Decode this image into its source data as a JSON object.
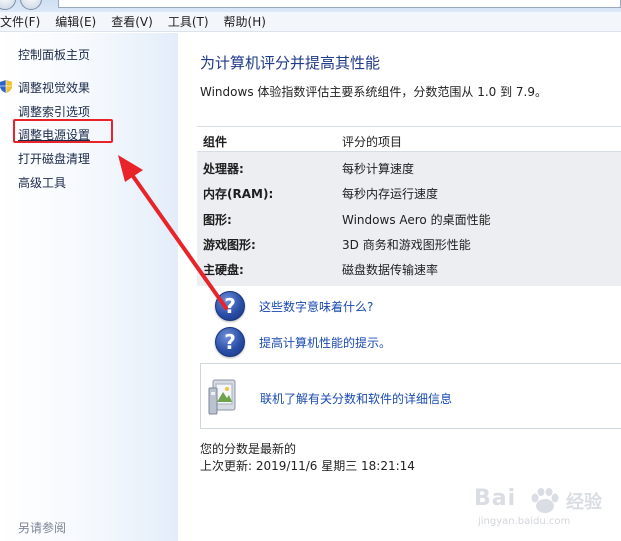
{
  "menu": [
    {
      "label": "文件(F)"
    },
    {
      "label": "编辑(E)"
    },
    {
      "label": "查看(V)"
    },
    {
      "label": "工具(T)"
    },
    {
      "label": "帮助(H)"
    }
  ],
  "sidebar": {
    "items": [
      {
        "label": "控制面板主页"
      },
      {
        "label": "调整视觉效果"
      },
      {
        "label": "调整索引选项"
      },
      {
        "label": "调整电源设置"
      },
      {
        "label": "打开磁盘清理"
      },
      {
        "label": "高级工具"
      }
    ],
    "see_also": "另请参阅"
  },
  "main": {
    "title": "为计算机评分并提高其性能",
    "description": "Windows 体验指数评估主要系统组件，分数范围从 1.0 到 7.9。",
    "table": {
      "headers": [
        "组件",
        "评分的项目"
      ],
      "rows": [
        {
          "component": "处理器:",
          "item": "每秒计算速度"
        },
        {
          "component": "内存(RAM):",
          "item": "每秒内存运行速度"
        },
        {
          "component": "图形:",
          "item": "Windows Aero 的桌面性能"
        },
        {
          "component": "游戏图形:",
          "item": "3D 商务和游戏图形性能"
        },
        {
          "component": "主硬盘:",
          "item": "磁盘数据传输速率"
        }
      ]
    },
    "help_links": [
      {
        "label": "这些数字意味着什么?",
        "icon": "question-icon"
      },
      {
        "label": "提高计算机性能的提示。",
        "icon": "question-icon"
      }
    ],
    "online_link": "联机了解有关分数和软件的详细信息",
    "score_status": "您的分数是最新的",
    "last_update": "上次更新: 2019/11/6 星期三 18:21:14"
  },
  "watermark": {
    "brand": "Bai",
    "brand_cn": "经验",
    "url": "jingyan.baidu.com"
  },
  "colors": {
    "link": "#1a4ab0",
    "title": "#1e3a8a",
    "annotation_red": "#e8242a"
  }
}
